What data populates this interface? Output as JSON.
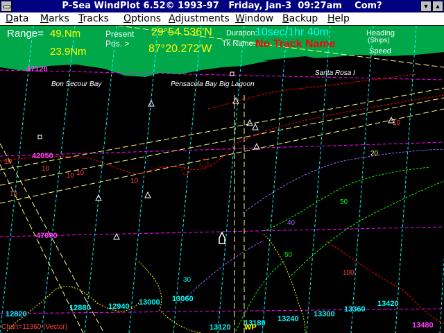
{
  "window": {
    "title": "P-Sea WindPlot 6.52© 1993-97   Friday, Jan-3  09:27am    Com?"
  },
  "menu": [
    {
      "label": "Data",
      "key": "D"
    },
    {
      "label": "Marks",
      "key": "M"
    },
    {
      "label": "Tracks",
      "key": "T"
    },
    {
      "label": "Options",
      "key": "O"
    },
    {
      "label": "Adjustments",
      "key": "A"
    },
    {
      "label": "Window",
      "key": "W"
    },
    {
      "label": "Backup",
      "key": "B"
    },
    {
      "label": "Help",
      "key": "H"
    }
  ],
  "hud": {
    "range_label": "Range=",
    "range1": "49.Nm",
    "range2": "23.9Nm",
    "present_label": "Present",
    "pos_label": "Pos. >",
    "lat": "29°54.536'N",
    "lon": "87°20.272'W",
    "duration_label": "Duration:",
    "duration": "10sec/1hr 40m",
    "tkname_label": "Tk Name:",
    "track_name": "No Track Name",
    "heading_label": "Heading",
    "ships_label": "(Ships)",
    "speed_label": "Speed"
  },
  "places": [
    {
      "name": "Bon Secour Bay"
    },
    {
      "name": "Pensacola Bay"
    },
    {
      "name": "Big Lagoon"
    },
    {
      "name": "Pensacola Bay"
    },
    {
      "name": "Santa Rosa I"
    }
  ],
  "lat_labels": [
    "47120",
    "42050",
    "47000"
  ],
  "td_labels": [
    "12820",
    "12880",
    "12940",
    "13000",
    "13060",
    "13120",
    "13180",
    "13240",
    "13300",
    "13360",
    "13420",
    "13480"
  ],
  "depth_labels": [
    "10",
    "10",
    "10",
    "10",
    "10",
    "10",
    "10",
    "20",
    "30",
    "40",
    "50",
    "50",
    "100"
  ],
  "waypoint_label": "WP",
  "chart_label": "Chart=11360 (Vector)",
  "colors": {
    "land": "#00a84a",
    "sea": "#000000",
    "title_bg": "#000080",
    "hud_yellow": "#ffff00",
    "hud_cyan": "#00ffff",
    "hud_red": "#ff0000",
    "grid_cyan": "#00ffff",
    "grid_magenta": "#ff00ff",
    "track_yellow": "#ffff80",
    "depth_red": "#ff0000",
    "depth_green": "#00ff00"
  }
}
